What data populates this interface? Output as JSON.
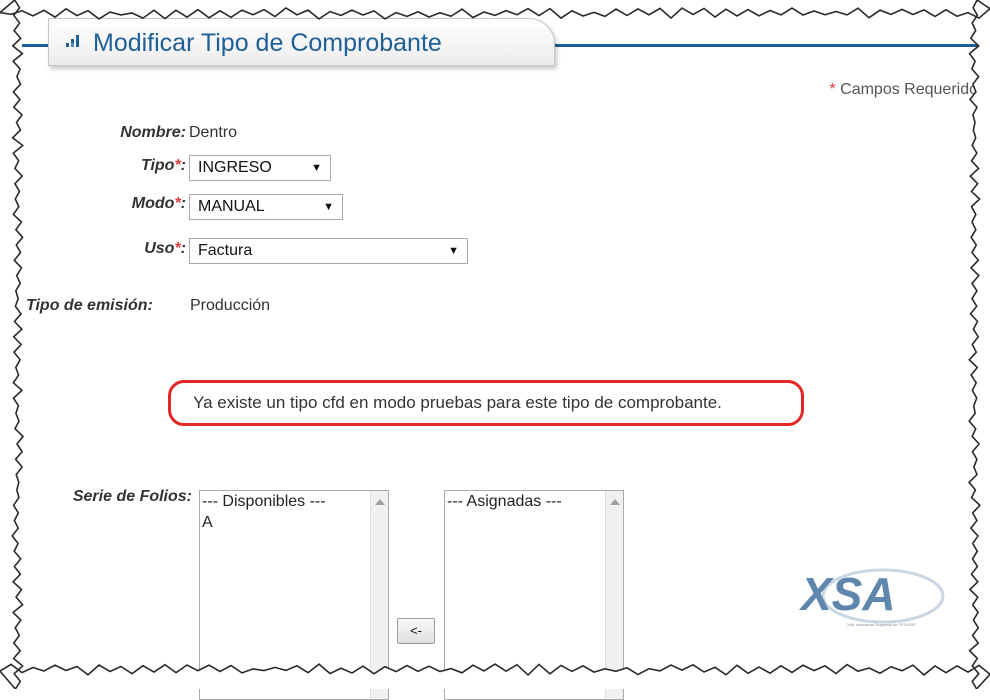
{
  "header": {
    "title": "Modificar Tipo de Comprobante"
  },
  "required_note": {
    "star": "*",
    "text": "Campos Requeridos"
  },
  "form": {
    "nombre": {
      "label": "Nombre:",
      "value": "Dentro"
    },
    "tipo": {
      "label": "Tipo",
      "star": "*",
      "colon": ":",
      "value": "INGRESO"
    },
    "modo": {
      "label": "Modo",
      "star": "*",
      "colon": ":",
      "value": "MANUAL"
    },
    "uso": {
      "label": "Uso",
      "star": "*",
      "colon": ":",
      "value": "Factura"
    },
    "tipo_emision": {
      "label": "Tipo de emisión:",
      "value": "Producción"
    }
  },
  "message": "Ya existe un tipo cfd en modo pruebas para este tipo de comprobante.",
  "folios": {
    "label": "Serie de Folios:",
    "disponibles": {
      "header": "--- Disponibles ---",
      "items": [
        "A"
      ]
    },
    "asignadas": {
      "header": "--- Asignadas ---",
      "items": []
    },
    "move_left_button": "<-"
  },
  "logo": {
    "text": "XSA",
    "tagline": "XML Aplicación Asignada de CFDI/SAT"
  },
  "colors": {
    "accent": "#1f5f98",
    "required": "#e03c3c",
    "alert_border": "#e32626"
  }
}
